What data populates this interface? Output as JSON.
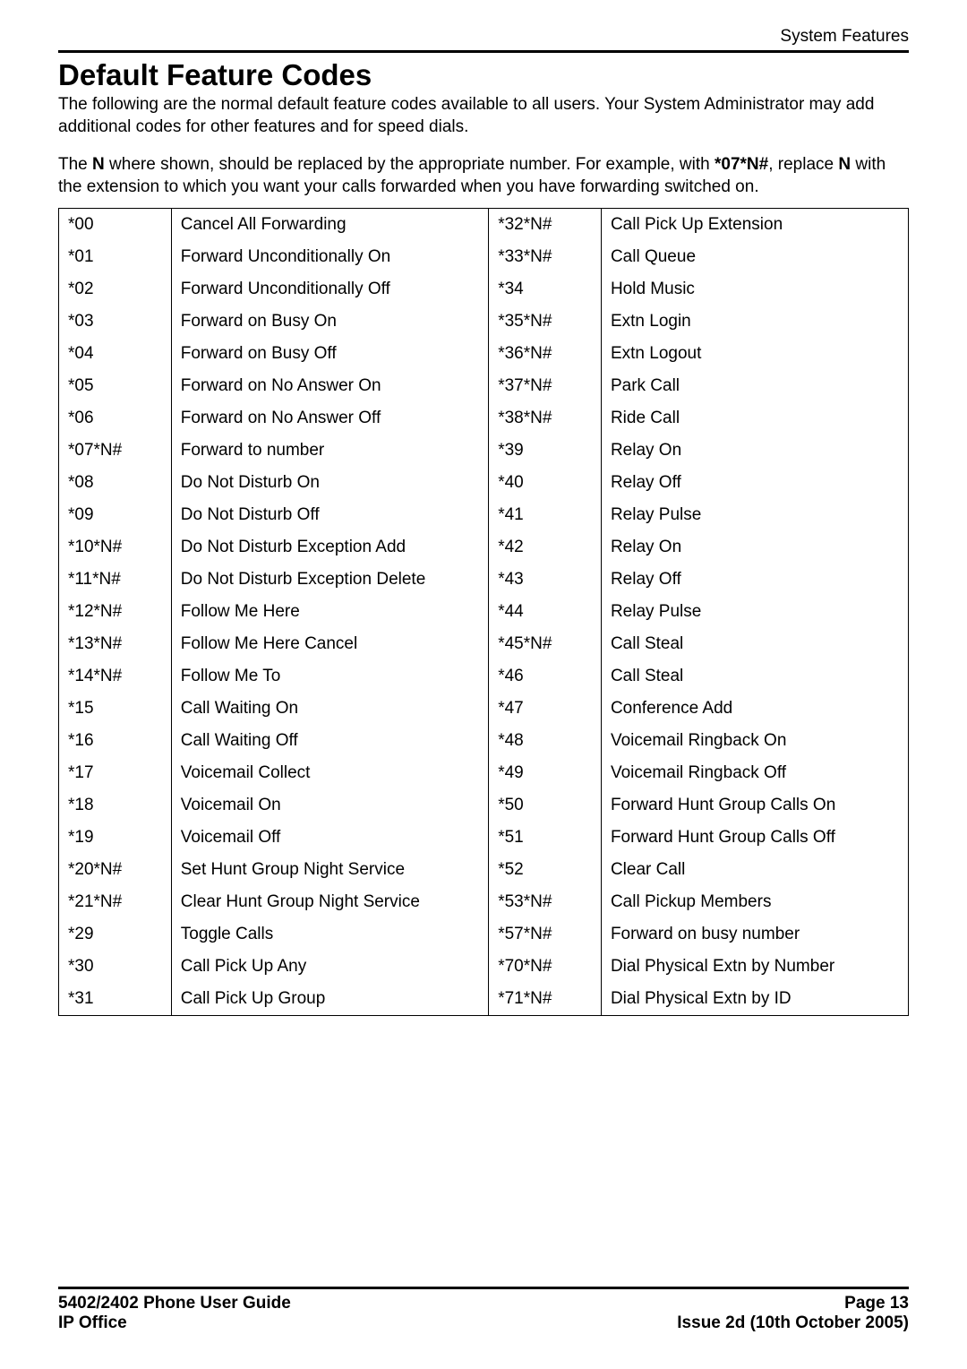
{
  "header": {
    "section_label": "System Features"
  },
  "title": "Default Feature Codes",
  "intro_p1": "The following are the normal default feature codes available to all users. Your System Administrator may add additional codes for other features and for speed dials.",
  "note_l1_a": "The ",
  "note_l1_b": "N",
  "note_l1_c": " where shown, should be replaced by the appropriate number. For example, with ",
  "note_l1_d": "*07*N#",
  "note_l1_e": ", replace ",
  "note_l2_a": "N",
  "note_l2_b": " with the extension to which you want your calls forwarded when you have forwarding switched on.",
  "rows": [
    {
      "c1": "*00",
      "d1": "Cancel All Forwarding",
      "c2": "*32*N#",
      "d2": "Call Pick Up Extension"
    },
    {
      "c1": "*01",
      "d1": "Forward Unconditionally On",
      "c2": "*33*N#",
      "d2": "Call Queue"
    },
    {
      "c1": "*02",
      "d1": "Forward Unconditionally Off",
      "c2": "*34",
      "d2": "Hold Music"
    },
    {
      "c1": "*03",
      "d1": "Forward on Busy On",
      "c2": "*35*N#",
      "d2": "Extn Login"
    },
    {
      "c1": "*04",
      "d1": "Forward on Busy Off",
      "c2": "*36*N#",
      "d2": "Extn Logout"
    },
    {
      "c1": "*05",
      "d1": "Forward on No Answer On",
      "c2": "*37*N#",
      "d2": "Park Call"
    },
    {
      "c1": "*06",
      "d1": "Forward on No Answer Off",
      "c2": "*38*N#",
      "d2": "Ride Call"
    },
    {
      "c1": "*07*N#",
      "d1": "Forward to number",
      "c2": "*39",
      "d2": "Relay On"
    },
    {
      "c1": "*08",
      "d1": "Do Not Disturb On",
      "c2": "*40",
      "d2": "Relay Off"
    },
    {
      "c1": "*09",
      "d1": "Do Not Disturb Off",
      "c2": "*41",
      "d2": "Relay Pulse"
    },
    {
      "c1": "*10*N#",
      "d1": "Do Not Disturb Exception Add",
      "c2": "*42",
      "d2": "Relay On"
    },
    {
      "c1": "*11*N#",
      "d1": "Do Not Disturb Exception Delete",
      "c2": "*43",
      "d2": "Relay Off"
    },
    {
      "c1": "*12*N#",
      "d1": "Follow Me Here",
      "c2": "*44",
      "d2": "Relay Pulse"
    },
    {
      "c1": "*13*N#",
      "d1": "Follow Me Here Cancel",
      "c2": "*45*N#",
      "d2": "Call Steal"
    },
    {
      "c1": "*14*N#",
      "d1": "Follow Me To",
      "c2": "*46",
      "d2": "Call Steal"
    },
    {
      "c1": "*15",
      "d1": "Call Waiting On",
      "c2": "*47",
      "d2": "Conference Add"
    },
    {
      "c1": "*16",
      "d1": "Call Waiting Off",
      "c2": "*48",
      "d2": "Voicemail Ringback On"
    },
    {
      "c1": "*17",
      "d1": "Voicemail Collect",
      "c2": "*49",
      "d2": "Voicemail Ringback Off"
    },
    {
      "c1": "*18",
      "d1": "Voicemail On",
      "c2": "*50",
      "d2": "Forward Hunt Group Calls On"
    },
    {
      "c1": "*19",
      "d1": "Voicemail Off",
      "c2": "*51",
      "d2": "Forward Hunt Group Calls Off"
    },
    {
      "c1": "*20*N#",
      "d1": "Set Hunt Group Night Service",
      "c2": "*52",
      "d2": "Clear Call"
    },
    {
      "c1": "*21*N#",
      "d1": "Clear Hunt Group Night Service",
      "c2": "*53*N#",
      "d2": "Call Pickup Members"
    },
    {
      "c1": "*29",
      "d1": "Toggle Calls",
      "c2": "*57*N#",
      "d2": "Forward on busy number"
    },
    {
      "c1": "*30",
      "d1": "Call Pick Up Any",
      "c2": "*70*N#",
      "d2": "Dial Physical Extn by Number"
    },
    {
      "c1": "*31",
      "d1": "Call Pick Up Group",
      "c2": "*71*N#",
      "d2": "Dial Physical Extn by ID"
    }
  ],
  "footer": {
    "left_line1": "5402/2402 Phone User Guide",
    "left_line2": "IP Office",
    "right_line1": "Page 13",
    "right_line2": "Issue 2d (10th October 2005)"
  }
}
